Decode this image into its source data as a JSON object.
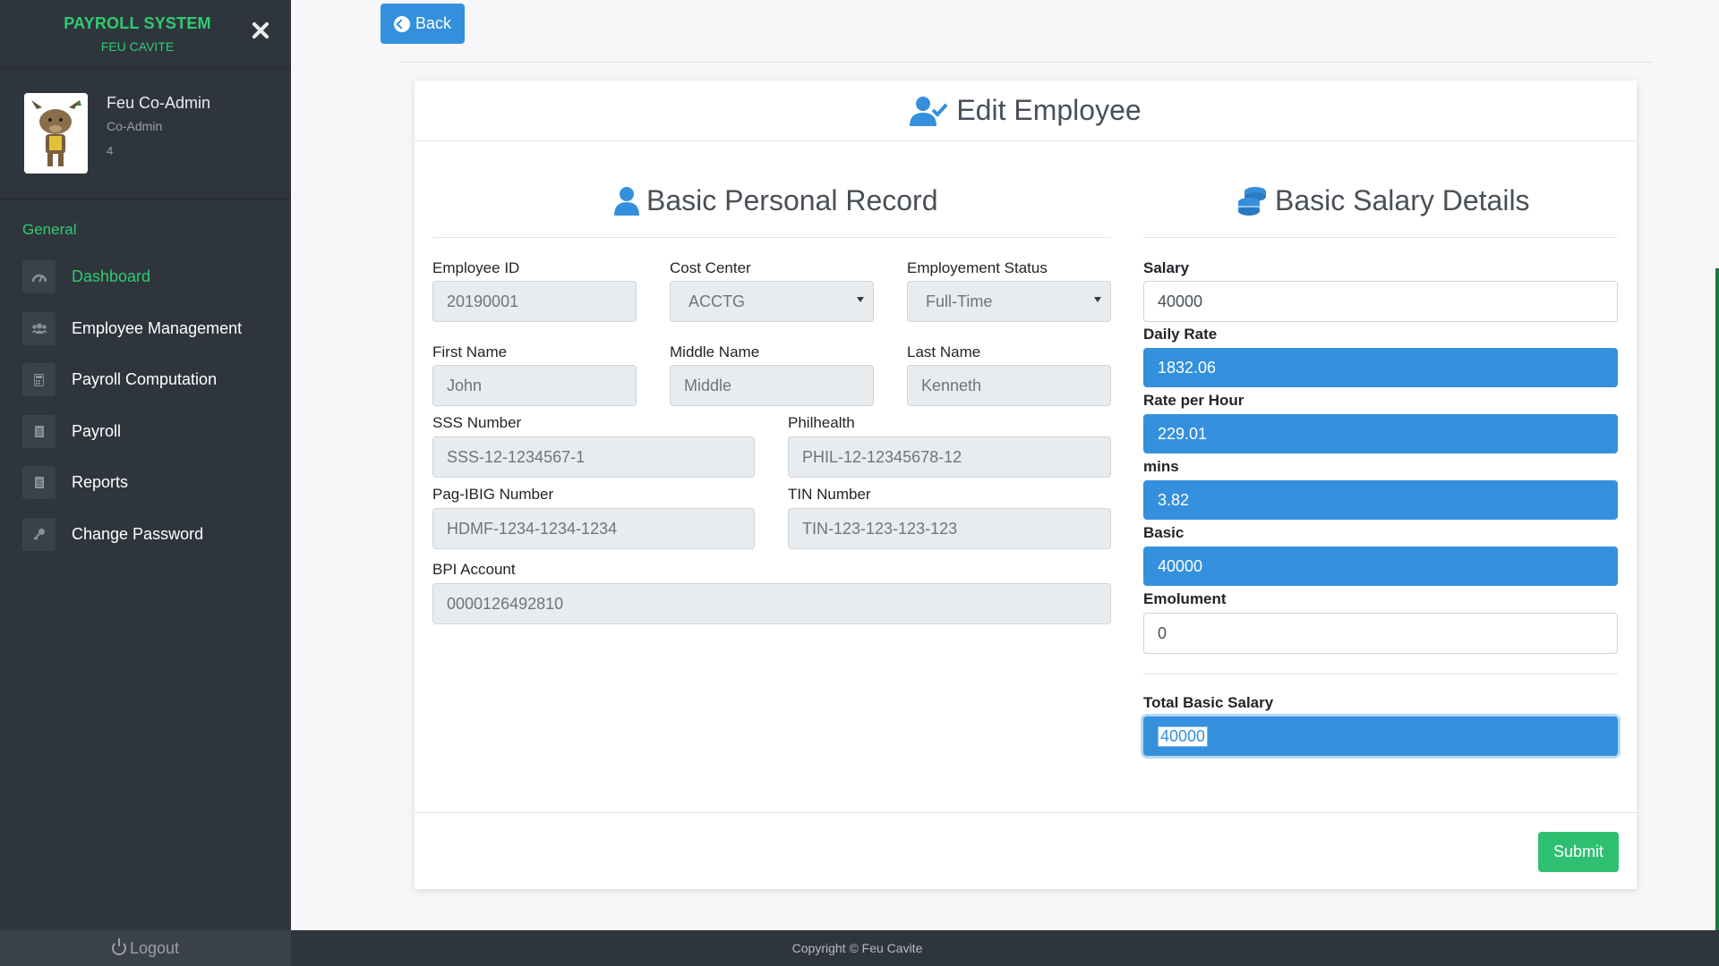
{
  "sidebar": {
    "brand_title": "PAYROLL SYSTEM",
    "brand_subtitle": "FEU CAVITE",
    "profile": {
      "name": "Feu Co-Admin",
      "role": "Co-Admin",
      "id": "4"
    },
    "nav_header": "General",
    "items": [
      {
        "label": "Dashboard",
        "icon": "dashboard-icon"
      },
      {
        "label": "Employee Management",
        "icon": "users-icon"
      },
      {
        "label": "Payroll Computation",
        "icon": "calculator-icon"
      },
      {
        "label": "Payroll",
        "icon": "file-icon"
      },
      {
        "label": "Reports",
        "icon": "file-icon"
      },
      {
        "label": "Change Password",
        "icon": "key-icon"
      }
    ],
    "logout_label": "Logout"
  },
  "back_label": "Back",
  "card": {
    "title": "Edit Employee",
    "submit_label": "Submit"
  },
  "personal": {
    "title": "Basic Personal Record",
    "employee_id": {
      "label": "Employee ID",
      "value": "20190001"
    },
    "cost_center": {
      "label": "Cost Center",
      "value": "ACCTG"
    },
    "status": {
      "label": "Employement Status",
      "value": "Full-Time"
    },
    "first_name": {
      "label": "First Name",
      "value": "John"
    },
    "middle_name": {
      "label": "Middle Name",
      "value": "Middle"
    },
    "last_name": {
      "label": "Last Name",
      "value": "Kenneth"
    },
    "sss": {
      "label": "SSS Number",
      "value": "SSS-12-1234567-1"
    },
    "philhealth": {
      "label": "Philhealth",
      "value": "PHIL-12-12345678-12"
    },
    "pagibig": {
      "label": "Pag-IBIG Number",
      "value": "HDMF-1234-1234-1234"
    },
    "tin": {
      "label": "TIN Number",
      "value": "TIN-123-123-123-123"
    },
    "bpi": {
      "label": "BPI Account",
      "value": "0000126492810"
    }
  },
  "salary": {
    "title": "Basic Salary Details",
    "salary": {
      "label": "Salary",
      "value": "40000"
    },
    "daily_rate": {
      "label": "Daily Rate",
      "value": "1832.06"
    },
    "rate_hour": {
      "label": "Rate per Hour",
      "value": "229.01"
    },
    "mins": {
      "label": "mins",
      "value": "3.82"
    },
    "basic": {
      "label": "Basic",
      "value": "40000"
    },
    "emolument": {
      "label": "Emolument",
      "value": "0"
    },
    "total": {
      "label": "Total Basic Salary",
      "value": "40000"
    }
  },
  "footer": "Copyright © Feu Cavite",
  "colors": {
    "sidebar": "#2f353d",
    "accent_green": "#2ecc71",
    "primary_blue": "#3490dc",
    "submit_green": "#2fbf71"
  }
}
